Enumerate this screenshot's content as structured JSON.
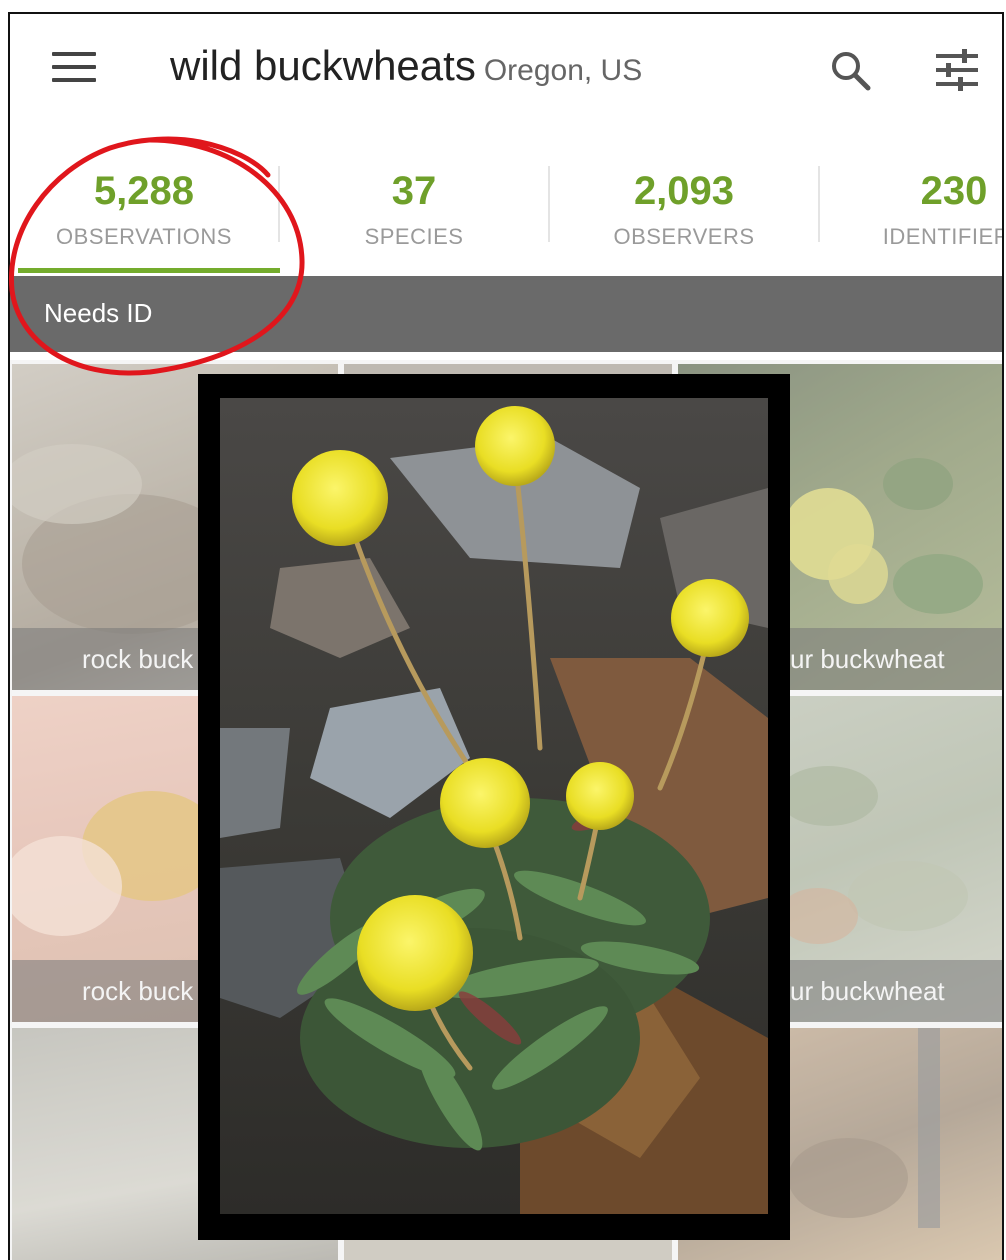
{
  "header": {
    "title": "wild buckwheats",
    "place": "Oregon, US",
    "icons": {
      "menu": "menu-icon",
      "search": "search-icon",
      "filter": "tune-icon"
    }
  },
  "stats": [
    {
      "value": "5,288",
      "label": "OBSERVATIONS",
      "active": true
    },
    {
      "value": "37",
      "label": "SPECIES",
      "active": false
    },
    {
      "value": "2,093",
      "label": "OBSERVERS",
      "active": false
    },
    {
      "value": "230",
      "label": "IDENTIFIERS",
      "active": false
    }
  ],
  "filter_bar": {
    "label": "Needs ID"
  },
  "grid": {
    "tiles": [
      {
        "caption": "rock buck"
      },
      {
        "caption": "ur buckwheat"
      },
      {
        "caption": "rock buck"
      },
      {
        "caption": "ur buckwheat"
      }
    ]
  },
  "colors": {
    "accent_green": "#6fa02a",
    "filter_bar": "#6a6a6a",
    "annotation_red": "#e0161c"
  }
}
